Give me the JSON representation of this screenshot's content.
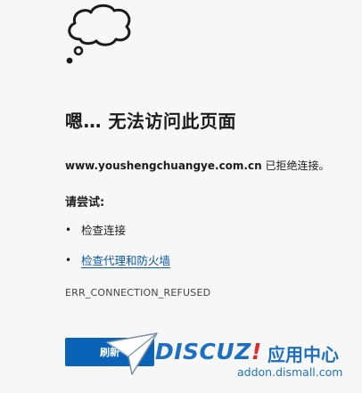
{
  "error_page": {
    "title": "嗯… 无法访问此页面",
    "host": "www.youshengchuangye.com.cn",
    "refused_message": " 已拒绝连接。",
    "try_heading": "请尝试:",
    "suggestions": [
      {
        "bullet": "•",
        "label": "检查连接",
        "is_link": false
      },
      {
        "bullet": "•",
        "label": "检查代理和防火墙",
        "is_link": true
      }
    ],
    "error_code": "ERR_CONNECTION_REFUSED",
    "refresh_label": "刷新"
  },
  "watermark": {
    "logo_text": "DISCUZ",
    "logo_mark": "!",
    "cn_text": "应用中心",
    "url": "addon.dismall.com"
  },
  "colors": {
    "background": "#f7f7f7",
    "button": "#0b63b8",
    "link": "#0a5aa8",
    "watermark_blue": "#1b6fc4",
    "watermark_red": "#e0282e"
  },
  "icons": {
    "top": "thought-cloud-icon",
    "watermark": "paper-plane-icon"
  }
}
